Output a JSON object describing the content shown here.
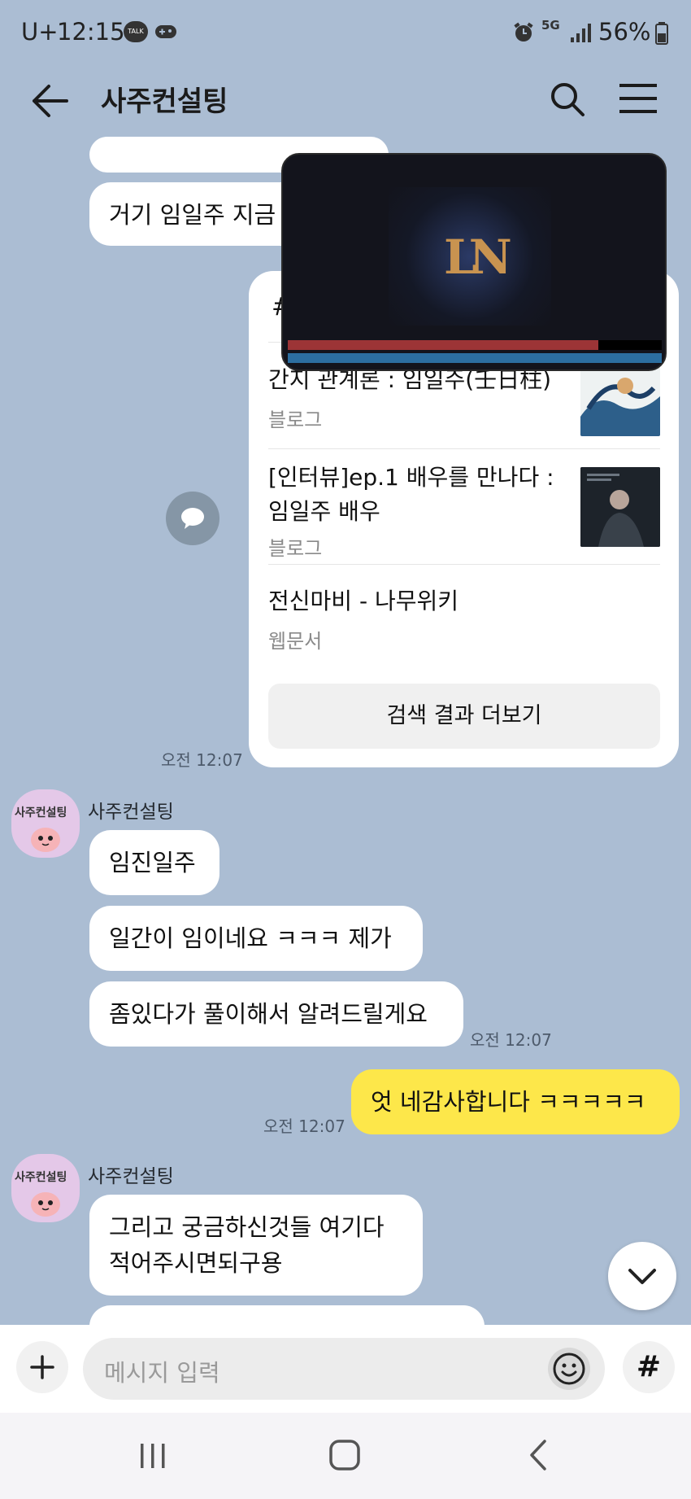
{
  "status_bar": {
    "carrier": "U+",
    "time": "12:15",
    "talk_badge": "TALK",
    "battery": "56%",
    "network": "5G"
  },
  "header": {
    "title": "사주컨설팅"
  },
  "messages": {
    "partial_top": "거기 임일주 지금",
    "card": {
      "hash_symbol": "#",
      "results": [
        {
          "title": "간지 관계론 : 임일주(壬日柱)",
          "source": "블로그"
        },
        {
          "title_line1": "[인터뷰]ep.1 배우를 만나다 :",
          "title_line2": "임일주 배우",
          "source": "블로그"
        },
        {
          "title": "전신마비 - 나무위키",
          "source": "웹문서"
        }
      ],
      "more_button": "검색 결과 더보기",
      "time": "오전 12:07"
    },
    "group1": {
      "sender": "사주컨설팅",
      "avatar_label": "사주컨설팅",
      "msg1": "임진일주",
      "msg2": "일간이 임이네요 ㅋㅋㅋ 제가",
      "msg3": "좀있다가 풀이해서 알려드릴게요",
      "time": "오전 12:07"
    },
    "mine": {
      "text": "엇 네감사합니다 ㅋㅋㅋㅋㅋ",
      "time": "오전 12:07"
    },
    "group2": {
      "sender": "사주컨설팅",
      "avatar_label": "사주컨설팅",
      "msg1_line1": "그리고 궁금하신것들 여기다",
      "msg1_line2": "적어주시면되구용"
    }
  },
  "video_overlay": {
    "logo": "LN",
    "progress_played": 0.83
  },
  "input_bar": {
    "placeholder": "메시지 입력",
    "hash": "#"
  },
  "colors": {
    "background": "#abbdd3",
    "my_bubble": "#fde74a",
    "video_progress_red": "#9c3436",
    "video_progress_blue": "#2c6ea0"
  }
}
